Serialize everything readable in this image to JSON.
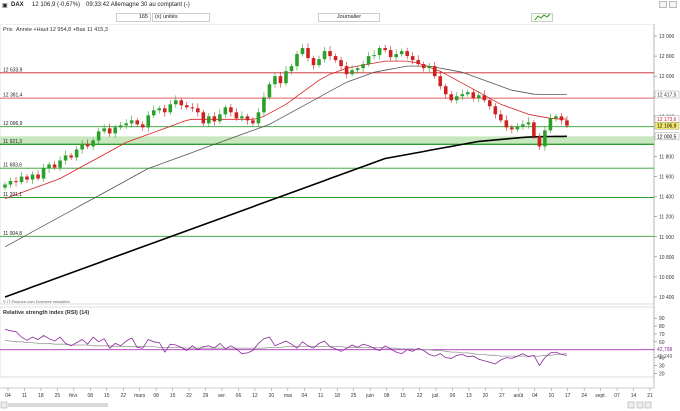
{
  "window": {
    "instrument": "DAX",
    "change": "12 106,9 (-0,67%)",
    "timestamp": "09:33:42 Allemagne 30 au comptant (-)"
  },
  "toolbar": {
    "quantity_value": "165",
    "units_label": "(x) unités",
    "period_select": "Journalier"
  },
  "price_panel": {
    "header": "Prix",
    "stats": "Année +Haut 12 954,8 +Bas 11 415,3",
    "source": "© IT-Finance.com Données retardées"
  },
  "levels": [
    {
      "value": "12 633,9",
      "price": 12633.9,
      "color": "#cc1f1f"
    },
    {
      "value": "12 381,4",
      "price": 12381.4,
      "color": "#e06060"
    },
    {
      "value": "12 096,9",
      "price": 12096.9,
      "color": "#2e9e2e"
    },
    {
      "value": "11 921,3",
      "price": 11921.3,
      "color": "#2e9e2e"
    },
    {
      "value": "11 683,6",
      "price": 11683.6,
      "color": "#2e9e2e"
    },
    {
      "value": "11 391,1",
      "price": 11391.1,
      "color": "#2e9e2e"
    },
    {
      "value": "11 004,8",
      "price": 11004.8,
      "color": "#2e9e2e"
    }
  ],
  "price_axis": {
    "ticks": [
      "13 000",
      "12 800",
      "12 600",
      "12 400",
      "12 200",
      "12 000",
      "11 800",
      "11 600",
      "11 400",
      "11 200",
      "11 000",
      "10 800",
      "10 600",
      "10 400"
    ],
    "tick_values": [
      13000,
      12800,
      12600,
      12400,
      12200,
      12000,
      11800,
      11600,
      11400,
      11200,
      11000,
      10800,
      10600,
      10400
    ],
    "badges": [
      {
        "label": "12 417,5",
        "price": 12417.5,
        "bg": "#ffffff",
        "fg": "#333333"
      },
      {
        "label": "12 173,6",
        "price": 12173.6,
        "bg": "#ffffff",
        "fg": "#cc1f1f"
      },
      {
        "label": "12 106,9",
        "price": 12106.9,
        "bg": "#f2e96b",
        "fg": "#000000"
      },
      {
        "label": "12 000,5",
        "price": 12000.5,
        "bg": "#ffffff",
        "fg": "#000000"
      }
    ]
  },
  "rsi_panel": {
    "header": "Relative strength index (RSI) (14)",
    "ticks": [
      "90",
      "80",
      "70",
      "60",
      "50",
      "40",
      "30",
      "20"
    ],
    "tick_values": [
      90,
      80,
      70,
      60,
      50,
      40,
      30,
      20
    ],
    "readout_rsi": "42,798",
    "readout_signal": "45,249",
    "level": 50
  },
  "x_axis": {
    "labels": [
      "04",
      "11",
      "18",
      "25",
      "févr.",
      "08",
      "15",
      "22",
      "mars",
      "08",
      "15",
      "22",
      "29",
      "avr.",
      "06",
      "12",
      "20",
      "mai",
      "04",
      "11",
      "18",
      "25",
      "juin",
      "08",
      "15",
      "22",
      "juil.",
      "06",
      "13",
      "20",
      "27",
      "août",
      "04",
      "10",
      "17",
      "24",
      "sept.",
      "07",
      "14",
      "21"
    ]
  },
  "chart_data": {
    "type": "candlestick",
    "ylim": [
      10350,
      13080
    ],
    "rsi_ylim": [
      18,
      94
    ],
    "close": [
      11520,
      11555,
      11545,
      11600,
      11570,
      11620,
      11580,
      11680,
      11720,
      11690,
      11760,
      11810,
      11790,
      11870,
      11920,
      11900,
      11960,
      12050,
      12080,
      12030,
      12090,
      12110,
      12130,
      12160,
      12120,
      12090,
      12210,
      12260,
      12280,
      12240,
      12320,
      12360,
      12310,
      12290,
      12280,
      12240,
      12130,
      12200,
      12150,
      12220,
      12290,
      12240,
      12180,
      12200,
      12160,
      12130,
      12240,
      12390,
      12520,
      12600,
      12530,
      12650,
      12700,
      12820,
      12880,
      12780,
      12710,
      12770,
      12850,
      12800,
      12760,
      12700,
      12620,
      12660,
      12680,
      12720,
      12800,
      12810,
      12880,
      12860,
      12790,
      12820,
      12850,
      12800,
      12760,
      12720,
      12680,
      12700,
      12600,
      12500,
      12420,
      12360,
      12400,
      12420,
      12440,
      12380,
      12410,
      12360,
      12300,
      12220,
      12160,
      12090,
      12070,
      12100,
      12120,
      12140,
      12000,
      11900,
      12060,
      12180,
      12200,
      12160,
      12106.9
    ],
    "ma20": [
      11380,
      11400,
      11420,
      11440,
      11460,
      11480,
      11500,
      11520,
      11540,
      11560,
      11580,
      11610,
      11640,
      11670,
      11700,
      11730,
      11760,
      11790,
      11820,
      11850,
      11880,
      11910,
      11940,
      11960,
      11980,
      12000,
      12020,
      12040,
      12060,
      12080,
      12100,
      12120,
      12140,
      12160,
      12170,
      12170,
      12170,
      12170,
      12170,
      12170,
      12170,
      12170,
      12170,
      12170,
      12170,
      12170,
      12180,
      12200,
      12230,
      12260,
      12290,
      12320,
      12360,
      12400,
      12440,
      12480,
      12520,
      12560,
      12590,
      12620,
      12640,
      12660,
      12680,
      12690,
      12700,
      12710,
      12720,
      12730,
      12740,
      12750,
      12750,
      12750,
      12750,
      12750,
      12740,
      12730,
      12710,
      12690,
      12670,
      12650,
      12620,
      12590,
      12560,
      12530,
      12500,
      12470,
      12440,
      12410,
      12380,
      12350,
      12320,
      12300,
      12280,
      12260,
      12240,
      12220,
      12210,
      12200,
      12190,
      12180,
      12175,
      12173.6,
      12173.6
    ],
    "ma50": [
      10900,
      10930,
      10960,
      10990,
      11020,
      11050,
      11080,
      11110,
      11140,
      11170,
      11200,
      11230,
      11260,
      11290,
      11320,
      11350,
      11380,
      11410,
      11440,
      11470,
      11500,
      11530,
      11560,
      11590,
      11620,
      11650,
      11680,
      11700,
      11720,
      11740,
      11760,
      11780,
      11800,
      11820,
      11840,
      11860,
      11880,
      11900,
      11920,
      11940,
      11960,
      11980,
      12000,
      12020,
      12040,
      12060,
      12080,
      12100,
      12120,
      12150,
      12180,
      12210,
      12240,
      12270,
      12300,
      12330,
      12360,
      12390,
      12420,
      12450,
      12480,
      12510,
      12540,
      12560,
      12580,
      12600,
      12620,
      12640,
      12650,
      12660,
      12670,
      12680,
      12690,
      12700,
      12700,
      12700,
      12700,
      12700,
      12690,
      12680,
      12670,
      12660,
      12650,
      12640,
      12620,
      12600,
      12580,
      12560,
      12540,
      12520,
      12500,
      12480,
      12460,
      12450,
      12440,
      12430,
      12420,
      12418,
      12417.5,
      12417.5,
      12417.5,
      12417.5,
      12417.5
    ],
    "ma200": [
      10400,
      10420,
      10440,
      10460,
      10480,
      10500,
      10520,
      10540,
      10560,
      10580,
      10600,
      10620,
      10640,
      10660,
      10680,
      10700,
      10720,
      10740,
      10760,
      10780,
      10800,
      10820,
      10840,
      10860,
      10880,
      10900,
      10920,
      10940,
      10960,
      10980,
      11000,
      11020,
      11040,
      11060,
      11080,
      11100,
      11120,
      11140,
      11160,
      11180,
      11200,
      11220,
      11240,
      11260,
      11280,
      11300,
      11320,
      11340,
      11360,
      11380,
      11400,
      11420,
      11440,
      11460,
      11480,
      11500,
      11520,
      11540,
      11560,
      11580,
      11600,
      11620,
      11640,
      11660,
      11680,
      11700,
      11720,
      11740,
      11760,
      11780,
      11790,
      11800,
      11810,
      11820,
      11830,
      11840,
      11850,
      11860,
      11870,
      11880,
      11890,
      11900,
      11910,
      11920,
      11930,
      11940,
      11950,
      11955,
      11960,
      11965,
      11970,
      11975,
      11980,
      11985,
      11990,
      11993,
      11995,
      11997,
      11998,
      11999,
      12000,
      12000.3,
      12000.5
    ],
    "rsi": [
      76,
      74,
      73,
      66,
      62,
      66,
      63,
      68,
      64,
      61,
      66,
      58,
      55,
      59,
      63,
      57,
      66,
      60,
      64,
      52,
      58,
      55,
      61,
      65,
      53,
      52,
      63,
      60,
      59,
      47,
      57,
      56,
      53,
      49,
      55,
      50,
      54,
      55,
      52,
      58,
      51,
      55,
      51,
      45,
      46,
      49,
      58,
      64,
      66,
      55,
      58,
      61,
      57,
      52,
      60,
      55,
      52,
      58,
      61,
      54,
      51,
      48,
      52,
      56,
      53,
      57,
      55,
      52,
      49,
      55,
      51,
      47,
      45,
      50,
      48,
      52,
      49,
      44,
      42,
      45,
      40,
      39,
      43,
      44,
      41,
      42,
      38,
      36,
      34,
      32,
      37,
      40,
      39,
      42,
      45,
      41,
      43,
      30,
      40,
      46,
      47,
      44,
      42.8
    ],
    "rsi_signal": [
      62,
      61,
      60,
      60,
      59,
      59,
      58,
      58,
      58,
      57,
      57,
      57,
      56,
      56,
      56,
      56,
      55,
      55,
      55,
      55,
      54,
      54,
      54,
      54,
      54,
      54,
      54,
      54,
      53,
      53,
      53,
      53,
      53,
      52,
      52,
      52,
      52,
      52,
      52,
      52,
      52,
      52,
      52,
      52,
      52,
      52,
      52,
      52,
      53,
      53,
      53,
      54,
      54,
      54,
      54,
      54,
      54,
      54,
      54,
      54,
      54,
      54,
      53,
      53,
      53,
      53,
      53,
      53,
      53,
      52,
      52,
      52,
      51,
      51,
      51,
      50,
      50,
      50,
      49,
      49,
      48,
      47,
      47,
      46,
      46,
      45,
      44,
      44,
      43,
      43,
      42,
      42,
      42,
      42,
      42,
      42,
      42,
      42,
      43,
      43,
      44,
      44.5,
      45.2
    ]
  }
}
